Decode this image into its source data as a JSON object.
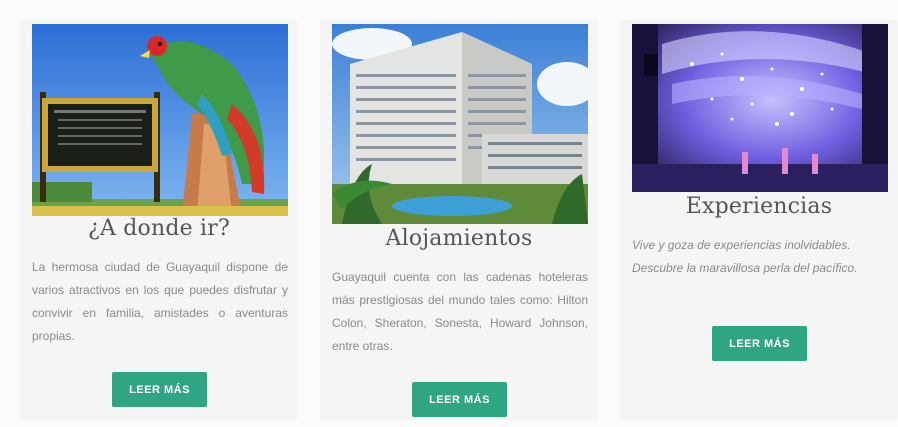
{
  "cards": [
    {
      "title": "¿A donde ir?",
      "text": "La hermosa ciudad de Guayaquil dispone de varios atractivos en los que puedes disfrutar y convivir en familia, amistades o aventuras propias.",
      "button": "LEER MÁS"
    },
    {
      "title": "Alojamientos",
      "text": "Guayaquil cuenta con las cadenas hoteleras más prestigiosas del mundo tales como: Hilton Colon, Sheraton, Sonesta, Howard Johnson, entre otras.",
      "button": "LEER MÁS"
    },
    {
      "title": "Experiencias",
      "text": "Vive y goza de experiencias inolvidables. Descubre la maravillosa perla del pacífico.",
      "button": "LEER MÁS"
    }
  ],
  "colors": {
    "button_bg": "#2fa584",
    "title": "#555555",
    "body_text": "#8a8a8a"
  },
  "images": [
    "parrot-monument-photo",
    "hotel-building-photo",
    "theater-stage-photo"
  ]
}
